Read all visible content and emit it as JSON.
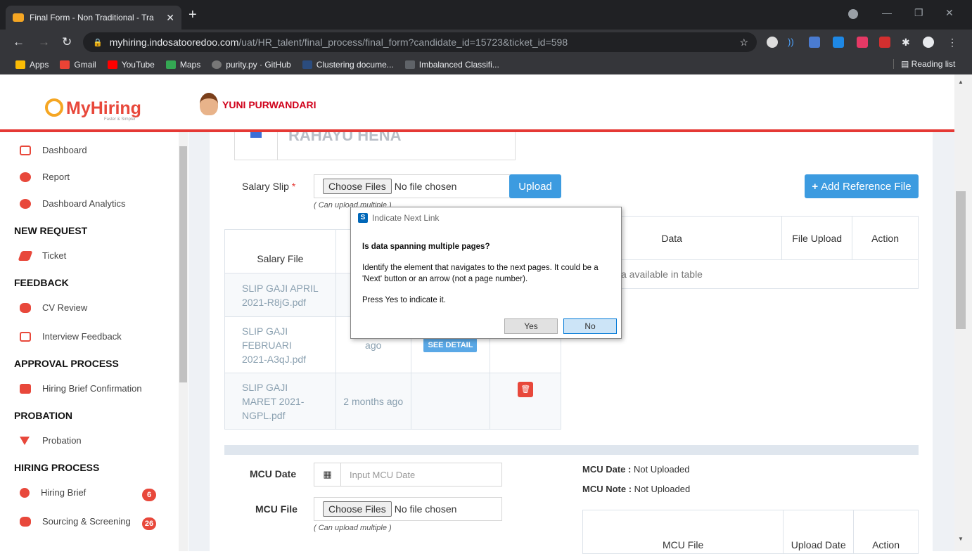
{
  "browser": {
    "tab_title": "Final Form - Non Traditional - Tra",
    "url_domain": "myhiring.indosatooredoo.com",
    "url_path": "/uat/HR_talent/final_process/final_form?candidate_id=15723&ticket_id=598",
    "bookmarks": [
      {
        "label": "Apps",
        "color": "#fbbc05"
      },
      {
        "label": "Gmail",
        "color": "#ea4335"
      },
      {
        "label": "YouTube",
        "color": "#ff0000"
      },
      {
        "label": "Maps",
        "color": "#34a853"
      },
      {
        "label": "purity.py · GitHub",
        "color": "#777777"
      },
      {
        "label": "Clustering docume...",
        "color": "#2b4c7e"
      },
      {
        "label": "Imbalanced Classifi...",
        "color": "#5f6368"
      }
    ],
    "reading_list": "Reading list"
  },
  "header": {
    "logo": "MyHiring",
    "logo_sub": "Faster & Simpler",
    "user": "YUNI PURWANDARI"
  },
  "sidebar": {
    "items": [
      {
        "label": "Dashboard",
        "icon": "monitor-icon"
      },
      {
        "label": "Report",
        "icon": "dashboard-icon"
      },
      {
        "label": "Dashboard Analytics",
        "icon": "dashboard-icon"
      },
      {
        "label": "Ticket",
        "icon": "ticket-icon"
      },
      {
        "label": "CV Review",
        "icon": "users-icon"
      },
      {
        "label": "Interview Feedback",
        "icon": "feedback-icon"
      },
      {
        "label": "Hiring Brief Confirmation",
        "icon": "thumbs-up-icon"
      },
      {
        "label": "Probation",
        "icon": "filter-icon"
      },
      {
        "label": "Hiring Brief",
        "icon": "half-circle-icon",
        "badge": "6"
      },
      {
        "label": "Sourcing & Screening",
        "icon": "users-icon",
        "badge": "26"
      }
    ],
    "headers": [
      "NEW REQUEST",
      "FEEDBACK",
      "APPROVAL PROCESS",
      "PROBATION",
      "HIRING PROCESS"
    ]
  },
  "main": {
    "name_partial": "RAHAYU HENA",
    "salary_slip_label": "Salary Slip",
    "required_mark": "*",
    "choose_files": "Choose Files",
    "no_file": "No file chosen",
    "upload": "Upload",
    "can_upload_multiple": "( Can upload multiple )",
    "add_reference": "Add Reference File",
    "salary_table": {
      "header": "Salary File",
      "rows": [
        {
          "file": "SLIP GAJI APRIL 2021-R8jG.pdf",
          "time": ""
        },
        {
          "file": "SLIP GAJI FEBRUARI 2021-A3qJ.pdf",
          "time": "ago"
        },
        {
          "file": "SLIP GAJI MARET 2021-NGPL.pdf",
          "time": "2 months ago"
        }
      ],
      "see_detail": "SEE DETAIL"
    },
    "ref_table": {
      "headers": [
        "Data",
        "File Upload",
        "Action"
      ],
      "empty": "a available in table"
    },
    "mcu_date_label": "MCU Date",
    "mcu_date_placeholder": "Input MCU Date",
    "mcu_file_label": "MCU File",
    "mcu_date_status_label": "MCU Date :",
    "mcu_date_status": "Not Uploaded",
    "mcu_note_status_label": "MCU Note :",
    "mcu_note_status": "Not Uploaded",
    "mcu_table": {
      "headers": [
        "MCU File",
        "Upload Date",
        "Action"
      ]
    }
  },
  "dialog": {
    "title": "Indicate Next Link",
    "question": "Is data spanning multiple pages?",
    "body": "Identify the element that navigates to the next pages. It could be a 'Next' button or an arrow (not a page number).",
    "prompt": "Press Yes to indicate it.",
    "yes": "Yes",
    "no": "No"
  }
}
